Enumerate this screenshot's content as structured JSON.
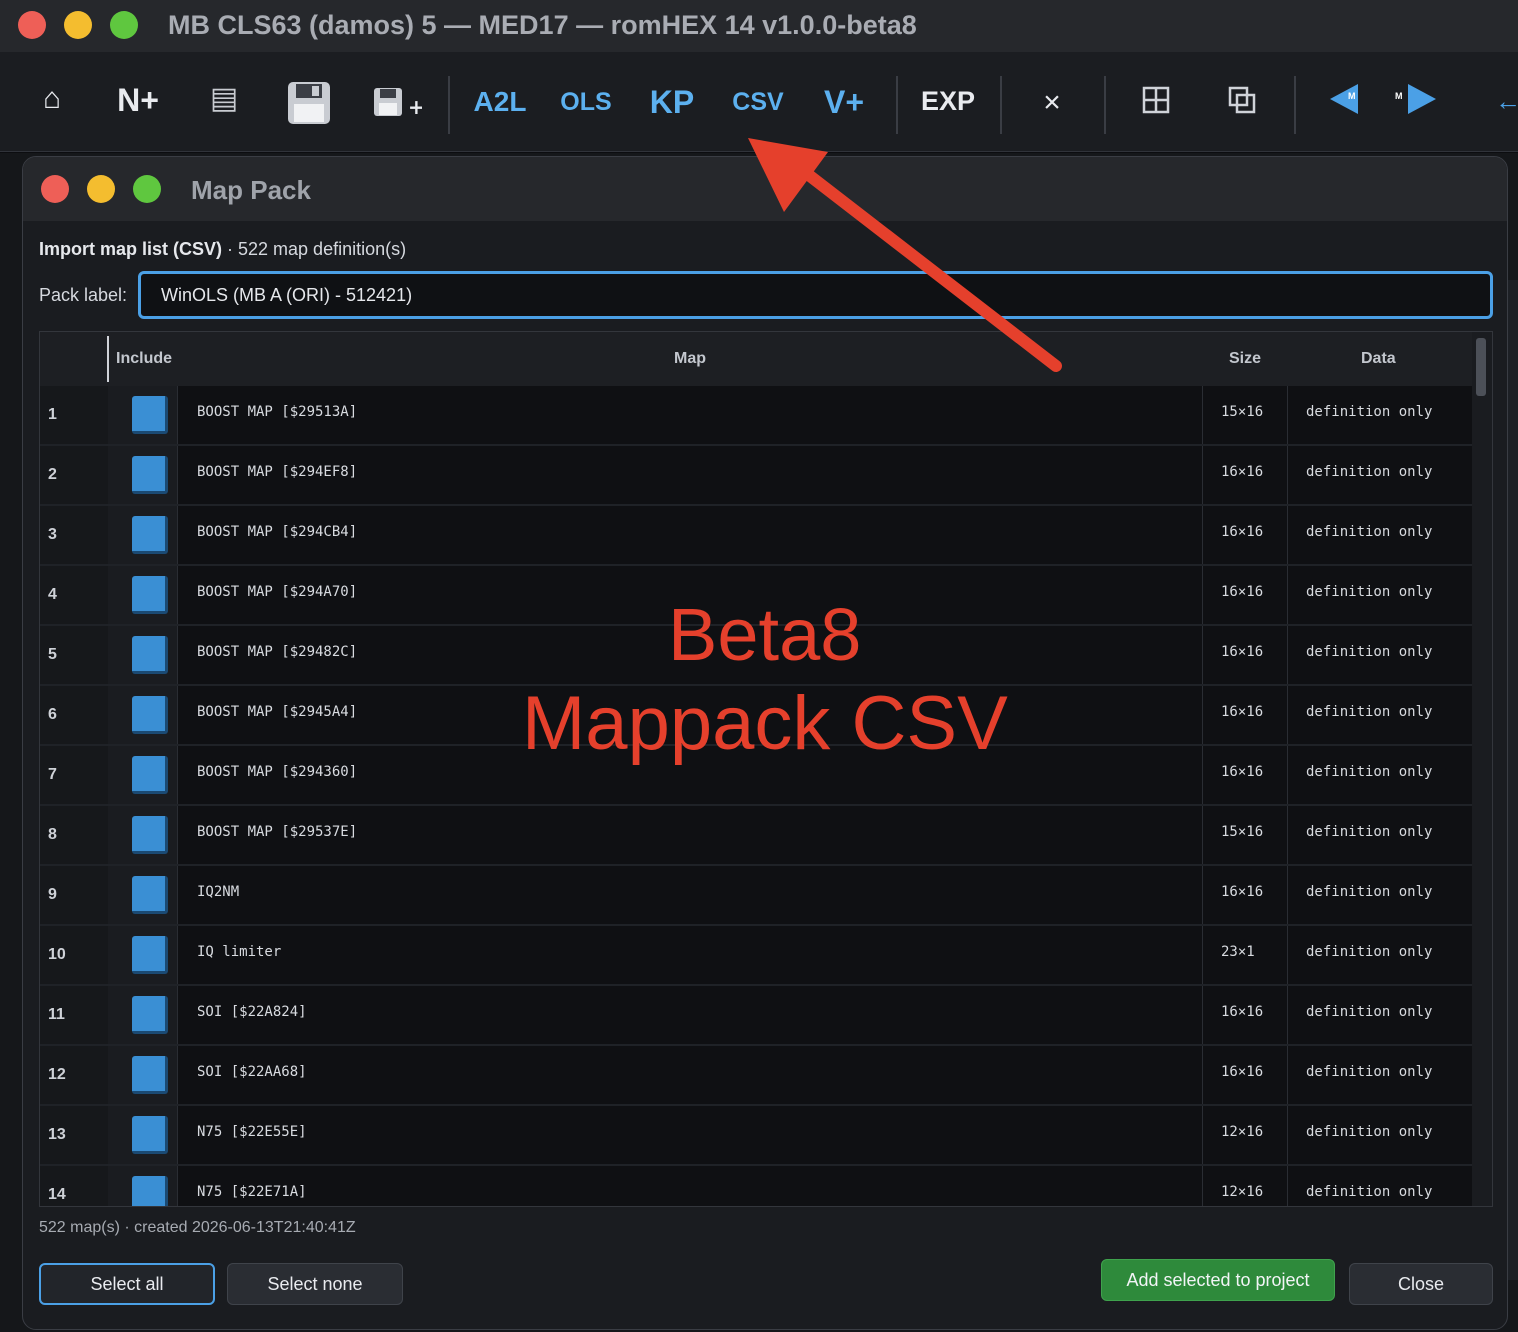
{
  "window": {
    "title": "MB CLS63 (damos) 5 — MED17 — romHEX 14 v1.0.0-beta8"
  },
  "toolbar": {
    "home_label": "⌂",
    "new_label": "N+",
    "list_label": "▤",
    "save_label": "💾",
    "save_plus_label": "+",
    "a2l_label": "A2L",
    "ols_label": "OLS",
    "kp_label": "KP",
    "csv_label": "CSV",
    "vplus_label": "V+",
    "exp_label": "EXP",
    "close_label": "×",
    "grid_label": "⊞",
    "window_label": "⧉",
    "prev_marker": "M",
    "next_marker": "M"
  },
  "dialog": {
    "title": "Map Pack",
    "import_heading": "Import map list (CSV)",
    "import_detail": " · 522 map definition(s)",
    "pack_label_text": "Pack label:",
    "pack_label_value": "WinOLS (MB A (ORI) - 512421)",
    "columns": {
      "include": "Include",
      "map": "Map",
      "size": "Size",
      "data": "Data"
    },
    "rows": [
      {
        "num": "1",
        "map": "BOOST MAP [$29513A]",
        "size": "15×16",
        "data": "definition only"
      },
      {
        "num": "2",
        "map": "BOOST MAP [$294EF8]",
        "size": "16×16",
        "data": "definition only"
      },
      {
        "num": "3",
        "map": "BOOST MAP [$294CB4]",
        "size": "16×16",
        "data": "definition only"
      },
      {
        "num": "4",
        "map": "BOOST MAP [$294A70]",
        "size": "16×16",
        "data": "definition only"
      },
      {
        "num": "5",
        "map": "BOOST MAP [$29482C]",
        "size": "16×16",
        "data": "definition only"
      },
      {
        "num": "6",
        "map": "BOOST MAP [$2945A4]",
        "size": "16×16",
        "data": "definition only"
      },
      {
        "num": "7",
        "map": "BOOST MAP [$294360]",
        "size": "16×16",
        "data": "definition only"
      },
      {
        "num": "8",
        "map": "BOOST MAP [$29537E]",
        "size": "15×16",
        "data": "definition only"
      },
      {
        "num": "9",
        "map": "IQ2NM",
        "size": "16×16",
        "data": "definition only"
      },
      {
        "num": "10",
        "map": "IQ limiter",
        "size": "23×1",
        "data": "definition only"
      },
      {
        "num": "11",
        "map": "SOI [$22A824]",
        "size": "16×16",
        "data": "definition only"
      },
      {
        "num": "12",
        "map": "SOI [$22AA68]",
        "size": "16×16",
        "data": "definition only"
      },
      {
        "num": "13",
        "map": "N75 [$22E55E]",
        "size": "12×16",
        "data": "definition only"
      },
      {
        "num": "14",
        "map": "N75 [$22E71A]",
        "size": "12×16",
        "data": "definition only"
      }
    ],
    "footer_info": "522 map(s)  ·  created 2026-06-13T21:40:41Z",
    "select_all_label": "Select all",
    "select_none_label": "Select none",
    "add_selected_label": "Add selected to project",
    "close_label": "Close"
  },
  "annotation": {
    "line1": "Beta8",
    "line2": "Mappack CSV"
  },
  "colors": {
    "accent_blue": "#4ba0e6",
    "checkbox_blue": "#3a8fd4",
    "add_button_green": "#2e8a3b",
    "annotation_red": "#e5402c",
    "traffic_red": "#ee5f57",
    "traffic_yellow": "#f4bd2f",
    "traffic_green": "#5fc73f"
  }
}
